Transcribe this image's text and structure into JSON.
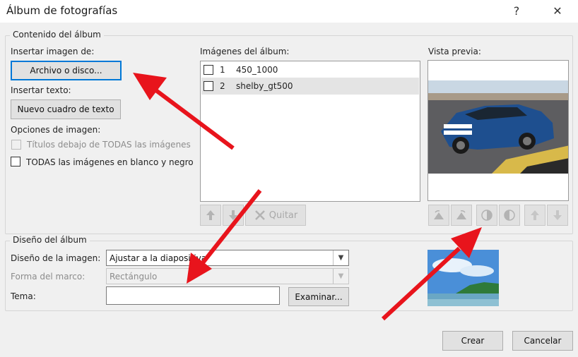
{
  "window": {
    "title": "Álbum de fotografías",
    "help": "?",
    "close": "✕"
  },
  "content_group": {
    "legend": "Contenido del álbum",
    "insert_image_label": "Insertar imagen de:",
    "file_button": "Archivo o disco...",
    "insert_text_label": "Insertar texto:",
    "new_textbox_button": "Nuevo cuadro de texto",
    "image_options_label": "Opciones de imagen:",
    "captions_option": "Títulos debajo de TODAS las imágenes",
    "bw_option": "TODAS las imágenes en blanco y negro"
  },
  "album_images": {
    "label": "Imágenes del álbum:",
    "items": [
      {
        "num": "1",
        "name": "450_1000",
        "checked": false,
        "selected": false
      },
      {
        "num": "2",
        "name": "shelby_gt500",
        "checked": false,
        "selected": true
      }
    ],
    "up_icon": "arrow-up-icon",
    "down_icon": "arrow-down-icon",
    "remove_button": "Quitar"
  },
  "preview": {
    "label": "Vista previa:"
  },
  "layout_group": {
    "legend": "Diseño del álbum",
    "picture_layout_label": "Diseño de la imagen:",
    "picture_layout_value": "Ajustar a la diapositiva",
    "frame_shape_label": "Forma del marco:",
    "frame_shape_value": "Rectángulo",
    "theme_label": "Tema:",
    "theme_value": "",
    "browse_button": "Examinar..."
  },
  "footer": {
    "create_button": "Crear",
    "cancel_button": "Cancelar"
  },
  "colors": {
    "annotation_arrow": "#e8141c",
    "focus_blue": "#0078d7"
  }
}
